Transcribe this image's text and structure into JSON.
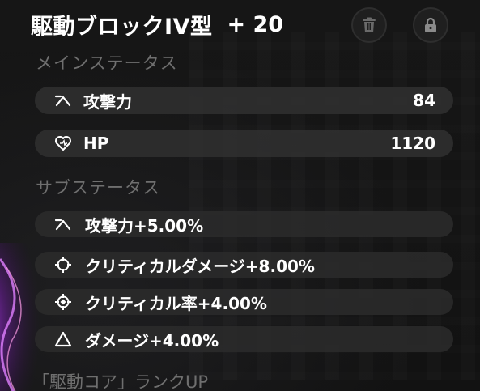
{
  "item": {
    "name": "駆動ブロックIV型",
    "level": "+ 20"
  },
  "icons": {
    "trash": "trash-icon",
    "lock": "lock-icon"
  },
  "main_status": {
    "heading": "メインステータス",
    "rows": [
      {
        "icon": "attack-icon",
        "label": "攻撃力",
        "value": "84"
      },
      {
        "icon": "heart-icon",
        "label": "HP",
        "value": "1120"
      }
    ]
  },
  "sub_status": {
    "heading": "サブステータス",
    "rows": [
      {
        "icon": "attack-icon",
        "label": "攻撃力+5.00%"
      },
      {
        "icon": "crit-damage-icon",
        "label": "クリティカルダメージ+8.00%"
      },
      {
        "icon": "crit-rate-icon",
        "label": "クリティカル率+4.00%"
      },
      {
        "icon": "damage-icon",
        "label": "ダメージ+4.00%"
      }
    ]
  },
  "rank_up": {
    "label": "「駆動コア」ランクUP"
  },
  "colors": {
    "row_bg": "#303030",
    "heading": "#6f6f6f",
    "text": "#ffffff"
  }
}
